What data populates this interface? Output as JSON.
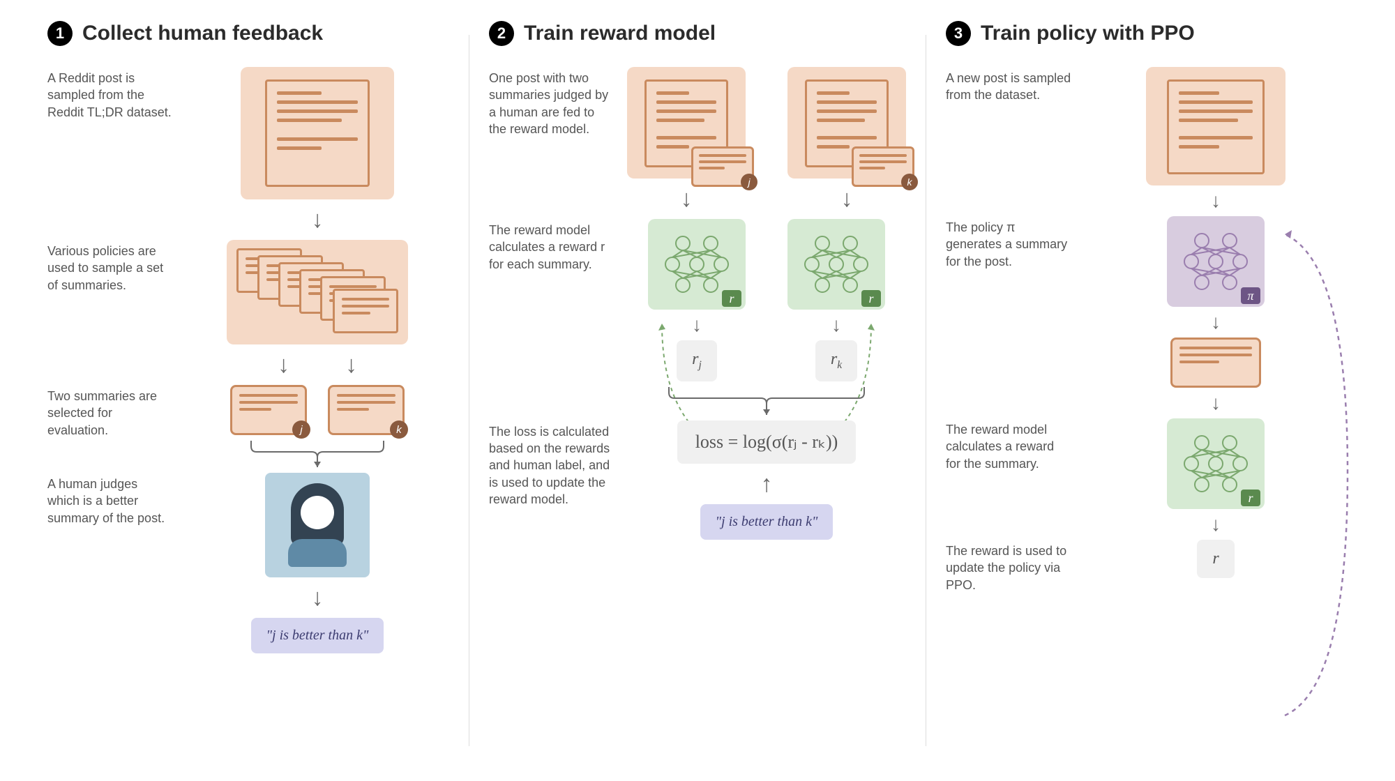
{
  "columns": [
    {
      "num": "1",
      "title": "Collect human feedback",
      "steps": {
        "s1": "A Reddit post is sampled from the Reddit TL;DR dataset.",
        "s2": "Various policies are used to sample a set of summaries.",
        "s3": "Two summaries are selected for evaluation.",
        "s4": "A human judges which is a better summary of the post."
      },
      "tags": {
        "j": "j",
        "k": "k"
      },
      "quote": "\"j is better than k\""
    },
    {
      "num": "2",
      "title": "Train reward model",
      "steps": {
        "s1": "One post with two summaries judged by a human are fed to the reward model.",
        "s2": "The reward model calculates a reward r for each summary.",
        "s3": "The loss is calculated based on the rewards and human label, and is used to update the reward model."
      },
      "tags": {
        "j": "j",
        "k": "k"
      },
      "nn_label": "r",
      "r_j": "r",
      "r_j_sub": "j",
      "r_k": "r",
      "r_k_sub": "k",
      "loss": "loss = log(σ(rⱼ - rₖ))",
      "quote": "\"j is better than k\""
    },
    {
      "num": "3",
      "title": "Train policy with PPO",
      "steps": {
        "s1": "A new post is sampled from the dataset.",
        "s2": "The policy π generates a summary for the post.",
        "s3": "The reward model calculates a reward for the summary.",
        "s4": "The reward is used to update the policy via PPO."
      },
      "policy_label": "π",
      "reward_label": "r",
      "r_out": "r"
    }
  ]
}
